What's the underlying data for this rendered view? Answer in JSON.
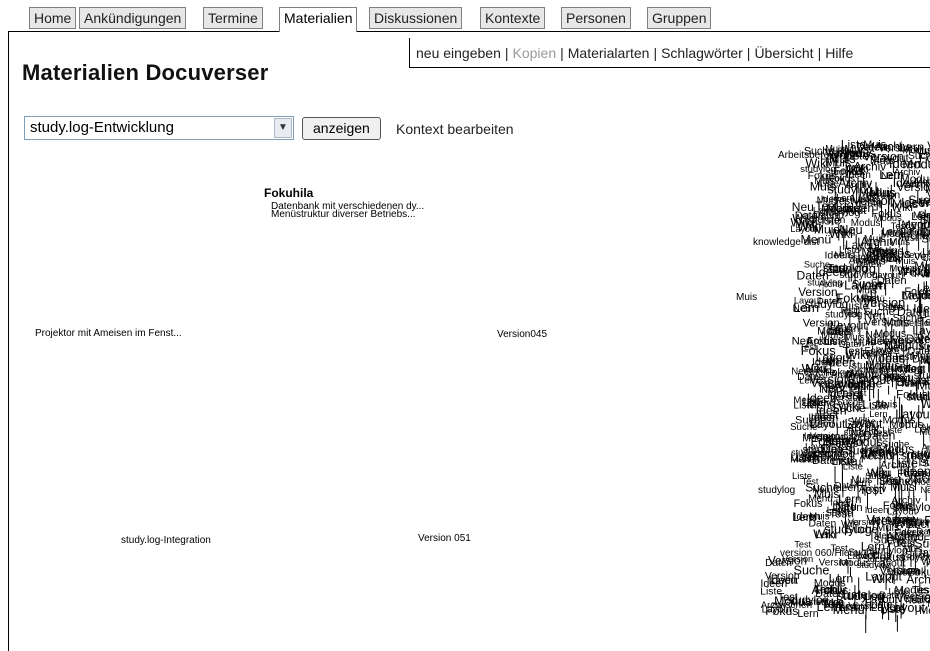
{
  "tabs": [
    {
      "label": "Home",
      "active": false
    },
    {
      "label": "Ankündigungen",
      "active": false
    },
    {
      "label": "Termine",
      "active": false
    },
    {
      "label": "Materialien",
      "active": true
    },
    {
      "label": "Diskussionen",
      "active": false
    },
    {
      "label": "Kontexte",
      "active": false
    },
    {
      "label": "Personen",
      "active": false
    },
    {
      "label": "Gruppen",
      "active": false
    }
  ],
  "subnav": {
    "items": [
      {
        "label": "neu eingeben",
        "dim": false
      },
      {
        "label": "Kopien",
        "dim": true
      },
      {
        "label": "Materialarten",
        "dim": false
      },
      {
        "label": "Schlagwörter",
        "dim": false
      },
      {
        "label": "Übersicht",
        "dim": false
      },
      {
        "label": "Hilfe",
        "dim": false
      }
    ],
    "separator": "|"
  },
  "page": {
    "title": "Materialien Docuverser",
    "context_select": "study.log-Entwicklung",
    "show_button": "anzeigen",
    "edit_context": "Kontext bearbeiten"
  },
  "graph": {
    "nodes": [
      {
        "label": "Fokuhila",
        "bold": true
      },
      {
        "label": "Datenbank mit verschiedenen dy..."
      },
      {
        "label": "Menüstruktur diverser Betriebs..."
      },
      {
        "label": "Projektor mit Ameisen im Fenst..."
      },
      {
        "label": "Version045"
      },
      {
        "label": "study.log-Integration"
      },
      {
        "label": "Version 051"
      },
      {
        "label": "knowledge dist"
      },
      {
        "label": "Arbeitsbereich"
      },
      {
        "label": "Muis"
      },
      {
        "label": "studylog"
      },
      {
        "label": "version 060/Hiera"
      },
      {
        "label": "zwischen"
      }
    ]
  }
}
